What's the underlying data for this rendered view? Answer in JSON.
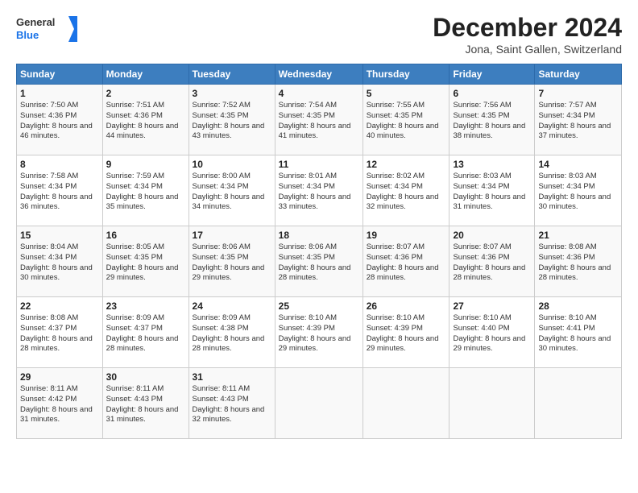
{
  "header": {
    "logo_general": "General",
    "logo_blue": "Blue",
    "month_title": "December 2024",
    "subtitle": "Jona, Saint Gallen, Switzerland"
  },
  "days_of_week": [
    "Sunday",
    "Monday",
    "Tuesday",
    "Wednesday",
    "Thursday",
    "Friday",
    "Saturday"
  ],
  "weeks": [
    [
      {
        "day": "1",
        "sunrise": "7:50 AM",
        "sunset": "4:36 PM",
        "daylight": "8 hours and 46 minutes."
      },
      {
        "day": "2",
        "sunrise": "7:51 AM",
        "sunset": "4:36 PM",
        "daylight": "8 hours and 44 minutes."
      },
      {
        "day": "3",
        "sunrise": "7:52 AM",
        "sunset": "4:35 PM",
        "daylight": "8 hours and 43 minutes."
      },
      {
        "day": "4",
        "sunrise": "7:54 AM",
        "sunset": "4:35 PM",
        "daylight": "8 hours and 41 minutes."
      },
      {
        "day": "5",
        "sunrise": "7:55 AM",
        "sunset": "4:35 PM",
        "daylight": "8 hours and 40 minutes."
      },
      {
        "day": "6",
        "sunrise": "7:56 AM",
        "sunset": "4:35 PM",
        "daylight": "8 hours and 38 minutes."
      },
      {
        "day": "7",
        "sunrise": "7:57 AM",
        "sunset": "4:34 PM",
        "daylight": "8 hours and 37 minutes."
      }
    ],
    [
      {
        "day": "8",
        "sunrise": "7:58 AM",
        "sunset": "4:34 PM",
        "daylight": "8 hours and 36 minutes."
      },
      {
        "day": "9",
        "sunrise": "7:59 AM",
        "sunset": "4:34 PM",
        "daylight": "8 hours and 35 minutes."
      },
      {
        "day": "10",
        "sunrise": "8:00 AM",
        "sunset": "4:34 PM",
        "daylight": "8 hours and 34 minutes."
      },
      {
        "day": "11",
        "sunrise": "8:01 AM",
        "sunset": "4:34 PM",
        "daylight": "8 hours and 33 minutes."
      },
      {
        "day": "12",
        "sunrise": "8:02 AM",
        "sunset": "4:34 PM",
        "daylight": "8 hours and 32 minutes."
      },
      {
        "day": "13",
        "sunrise": "8:03 AM",
        "sunset": "4:34 PM",
        "daylight": "8 hours and 31 minutes."
      },
      {
        "day": "14",
        "sunrise": "8:03 AM",
        "sunset": "4:34 PM",
        "daylight": "8 hours and 30 minutes."
      }
    ],
    [
      {
        "day": "15",
        "sunrise": "8:04 AM",
        "sunset": "4:34 PM",
        "daylight": "8 hours and 30 minutes."
      },
      {
        "day": "16",
        "sunrise": "8:05 AM",
        "sunset": "4:35 PM",
        "daylight": "8 hours and 29 minutes."
      },
      {
        "day": "17",
        "sunrise": "8:06 AM",
        "sunset": "4:35 PM",
        "daylight": "8 hours and 29 minutes."
      },
      {
        "day": "18",
        "sunrise": "8:06 AM",
        "sunset": "4:35 PM",
        "daylight": "8 hours and 28 minutes."
      },
      {
        "day": "19",
        "sunrise": "8:07 AM",
        "sunset": "4:36 PM",
        "daylight": "8 hours and 28 minutes."
      },
      {
        "day": "20",
        "sunrise": "8:07 AM",
        "sunset": "4:36 PM",
        "daylight": "8 hours and 28 minutes."
      },
      {
        "day": "21",
        "sunrise": "8:08 AM",
        "sunset": "4:36 PM",
        "daylight": "8 hours and 28 minutes."
      }
    ],
    [
      {
        "day": "22",
        "sunrise": "8:08 AM",
        "sunset": "4:37 PM",
        "daylight": "8 hours and 28 minutes."
      },
      {
        "day": "23",
        "sunrise": "8:09 AM",
        "sunset": "4:37 PM",
        "daylight": "8 hours and 28 minutes."
      },
      {
        "day": "24",
        "sunrise": "8:09 AM",
        "sunset": "4:38 PM",
        "daylight": "8 hours and 28 minutes."
      },
      {
        "day": "25",
        "sunrise": "8:10 AM",
        "sunset": "4:39 PM",
        "daylight": "8 hours and 29 minutes."
      },
      {
        "day": "26",
        "sunrise": "8:10 AM",
        "sunset": "4:39 PM",
        "daylight": "8 hours and 29 minutes."
      },
      {
        "day": "27",
        "sunrise": "8:10 AM",
        "sunset": "4:40 PM",
        "daylight": "8 hours and 29 minutes."
      },
      {
        "day": "28",
        "sunrise": "8:10 AM",
        "sunset": "4:41 PM",
        "daylight": "8 hours and 30 minutes."
      }
    ],
    [
      {
        "day": "29",
        "sunrise": "8:11 AM",
        "sunset": "4:42 PM",
        "daylight": "8 hours and 31 minutes."
      },
      {
        "day": "30",
        "sunrise": "8:11 AM",
        "sunset": "4:43 PM",
        "daylight": "8 hours and 31 minutes."
      },
      {
        "day": "31",
        "sunrise": "8:11 AM",
        "sunset": "4:43 PM",
        "daylight": "8 hours and 32 minutes."
      },
      null,
      null,
      null,
      null
    ]
  ],
  "labels": {
    "sunrise": "Sunrise:",
    "sunset": "Sunset:",
    "daylight": "Daylight:"
  }
}
